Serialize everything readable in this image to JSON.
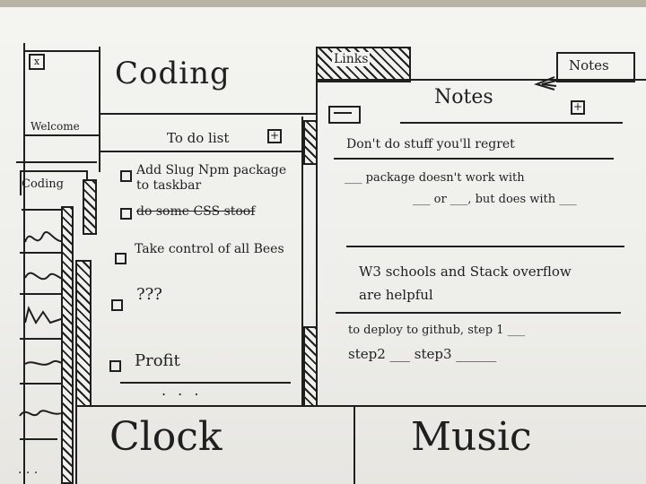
{
  "header": {
    "close_glyph": "x",
    "coding_title": "Coding",
    "tabs": [
      {
        "label": "Links"
      },
      {
        "label": "Notes"
      }
    ]
  },
  "sidebar": {
    "welcome": "Welcome",
    "active_tab": "Coding"
  },
  "todo": {
    "title": "To do list",
    "add_glyph": "⊞",
    "items": [
      {
        "text": "Add Slug Npm package to taskbar",
        "checked": false,
        "struck": false
      },
      {
        "text": "do some CSS stoof",
        "checked": false,
        "struck": true
      },
      {
        "text": "Take control of all Bees",
        "checked": false,
        "struck": false
      },
      {
        "text": "???",
        "checked": false,
        "struck": false
      },
      {
        "text": "Profit",
        "checked": false,
        "struck": false
      }
    ],
    "more": ". . ."
  },
  "notes": {
    "title": "Notes",
    "add_glyph": "⊞",
    "entries": [
      "Don't do stuff you'll regret",
      "___ package doesn't work with",
      "___ or ___, but does with ___",
      "W3 schools and Stack overflow",
      "are helpful",
      "to deploy to github, step 1 ___",
      "step2 ___  step3 ______"
    ]
  },
  "widgets": {
    "clock": "Clock",
    "music": "Music"
  }
}
